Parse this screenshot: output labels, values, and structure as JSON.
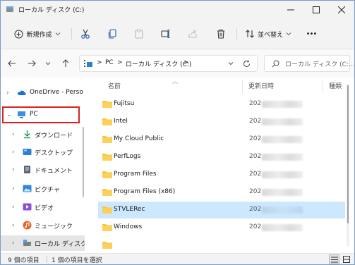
{
  "window": {
    "title": "ローカル ディスク (C:)",
    "minimize_icon": "minimize-icon",
    "maximize_icon": "maximize-icon",
    "close_icon": "close-icon"
  },
  "toolbar": {
    "new_label": "新規作成",
    "sort_label": "並べ替え",
    "more_label": "•••"
  },
  "address": {
    "parts": [
      ">",
      "PC",
      ">",
      "ローカル ディスク (C:)",
      ">"
    ],
    "search_placeholder": "ローカル ディスク (C:..."
  },
  "nav_pane": {
    "items": [
      {
        "label": "OneDrive - Perso",
        "icon": "onedrive-icon"
      },
      {
        "label": "PC",
        "icon": "pc-icon"
      },
      {
        "label": "ダウンロード",
        "icon": "download-icon"
      },
      {
        "label": "デスクトップ",
        "icon": "desktop-icon"
      },
      {
        "label": "ドキュメント",
        "icon": "documents-icon"
      },
      {
        "label": "ピクチャ",
        "icon": "pictures-icon"
      },
      {
        "label": "ビデオ",
        "icon": "videos-icon"
      },
      {
        "label": "ミュージック",
        "icon": "music-icon"
      },
      {
        "label": "ローカル ディスク (",
        "icon": "drive-icon"
      }
    ]
  },
  "file_list": {
    "columns": [
      "名前",
      "更新日時",
      "種類"
    ],
    "rows": [
      {
        "name": "Fujitsu",
        "date": "202"
      },
      {
        "name": "Intel",
        "date": "202"
      },
      {
        "name": "My Cloud Public",
        "date": "202"
      },
      {
        "name": "PerfLogs",
        "date": "202"
      },
      {
        "name": "Program Files",
        "date": "202"
      },
      {
        "name": "Program Files (x86)",
        "date": "202"
      },
      {
        "name": "STVLERec",
        "date": "202",
        "selected": true
      },
      {
        "name": "Windows",
        "date": "202"
      }
    ]
  },
  "status": {
    "item_count": "9 個の項目",
    "selected_count": "1 個の項目を選択"
  },
  "colors": {
    "accent": "#0067c0",
    "selection": "#cce8ff",
    "highlight_box": "#e02020",
    "folder": "#f8c53a"
  }
}
